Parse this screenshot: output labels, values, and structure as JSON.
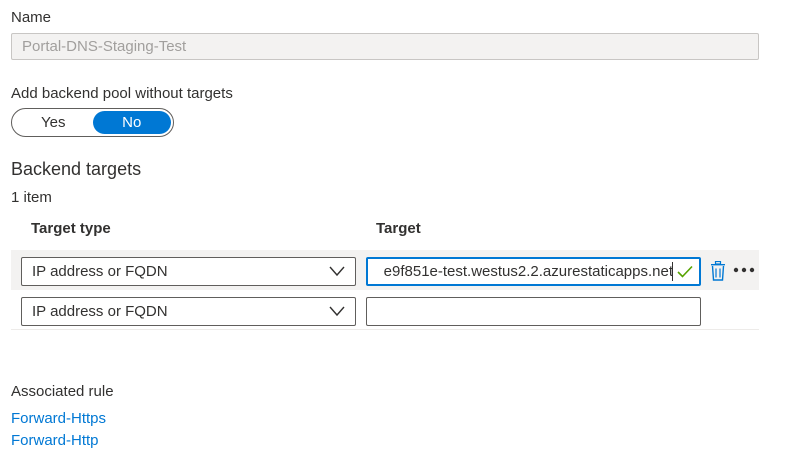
{
  "name_field": {
    "label": "Name",
    "value": "Portal-DNS-Staging-Test"
  },
  "backend_pool_toggle": {
    "label": "Add backend pool without targets",
    "yes": "Yes",
    "no": "No",
    "selected": "No"
  },
  "backend_targets": {
    "title": "Backend targets",
    "count": "1 item",
    "columns": {
      "target_type": "Target type",
      "target": "Target"
    },
    "rows": [
      {
        "target_type": "IP address or FQDN",
        "target": "e9f851e-test.westus2.2.azurestaticapps.net"
      },
      {
        "target_type": "IP address or FQDN",
        "target": ""
      }
    ]
  },
  "associated_rule": {
    "label": "Associated rule",
    "links": [
      "Forward-Https",
      "Forward-Http"
    ]
  },
  "colors": {
    "accent": "#0078d4",
    "valid": "#57a300",
    "row_highlight": "#f3f2f1"
  }
}
